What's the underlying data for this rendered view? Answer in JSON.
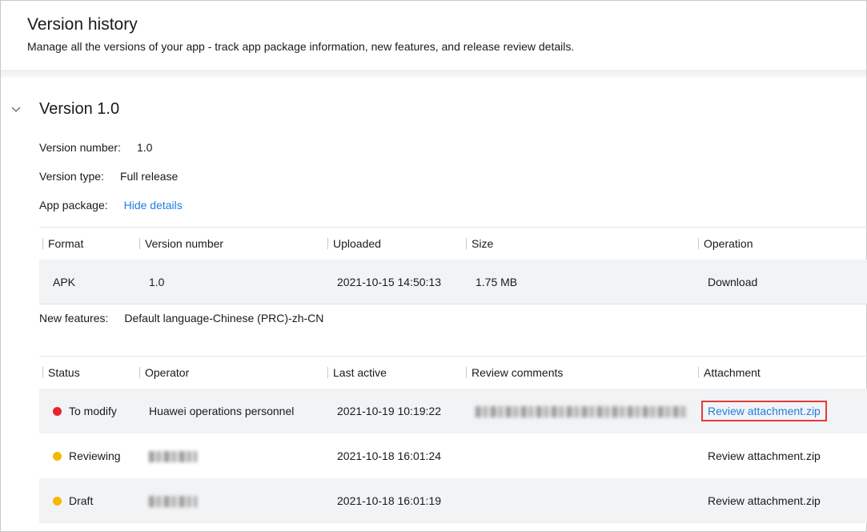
{
  "header": {
    "title": "Version history",
    "subtitle": "Manage all the versions of your app - track app package information, new features, and release review details."
  },
  "version": {
    "title": "Version 1.0",
    "number_label": "Version number:",
    "number_value": "1.0",
    "type_label": "Version type:",
    "type_value": "Full release",
    "package_label": "App package:",
    "package_link": "Hide details",
    "features_label": "New features:",
    "features_value": "Default language-Chinese (PRC)-zh-CN"
  },
  "package_table": {
    "headers": [
      "Format",
      "Version number",
      "Uploaded",
      "Size",
      "Operation"
    ],
    "rows": [
      {
        "format": "APK",
        "version": "1.0",
        "uploaded": "2021-10-15 14:50:13",
        "size": "1.75 MB",
        "operation": "Download"
      }
    ]
  },
  "review_table": {
    "headers": [
      "Status",
      "Operator",
      "Last active",
      "Review comments",
      "Attachment"
    ],
    "rows": [
      {
        "status": "To modify",
        "status_color": "#e8222f",
        "operator": "Huawei operations personnel",
        "last_active": "2021-10-19 10:19:22",
        "attachment": "Review attachment.zip"
      },
      {
        "status": "Reviewing",
        "status_color": "#f5b800",
        "operator": "",
        "last_active": "2021-10-18 16:01:24",
        "attachment": "Review attachment.zip"
      },
      {
        "status": "Draft",
        "status_color": "#f5b800",
        "operator": "",
        "last_active": "2021-10-18 16:01:19",
        "attachment": "Review attachment.zip"
      }
    ]
  },
  "colors": {
    "link": "#1e7fe0",
    "highlight": "#e03c3c"
  }
}
